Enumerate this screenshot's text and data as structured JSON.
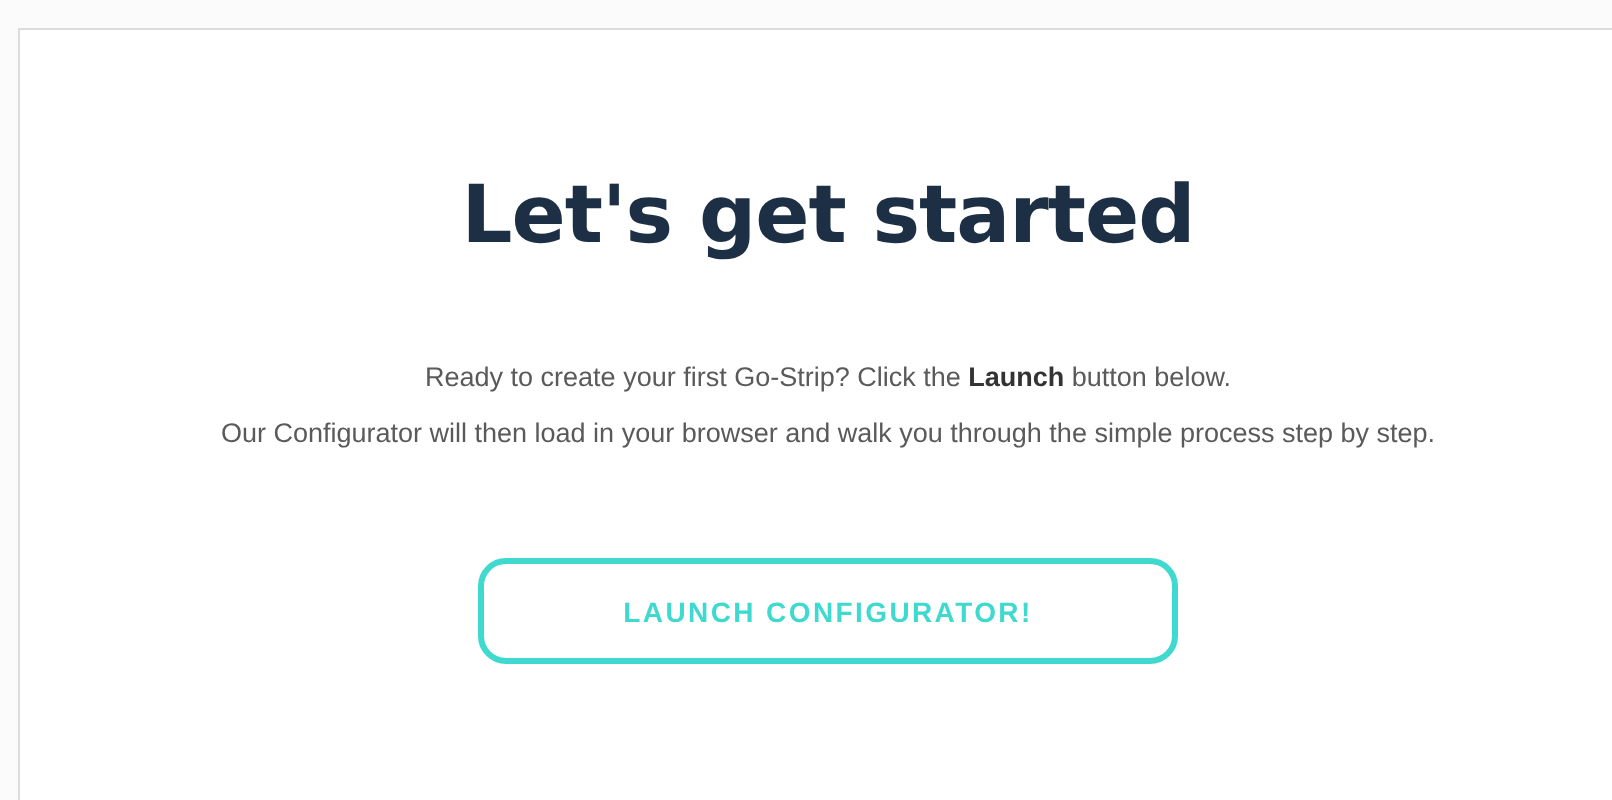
{
  "heading": "Let's get started",
  "intro_lines": [
    "Ready to create your first Go-Strip? Click the **Launch** button below.",
    "Our Configurator will then load in your browser and walk you through the simple process step by step."
  ],
  "launch_button": {
    "label": "LAUNCH CONFIGURATOR!"
  }
}
